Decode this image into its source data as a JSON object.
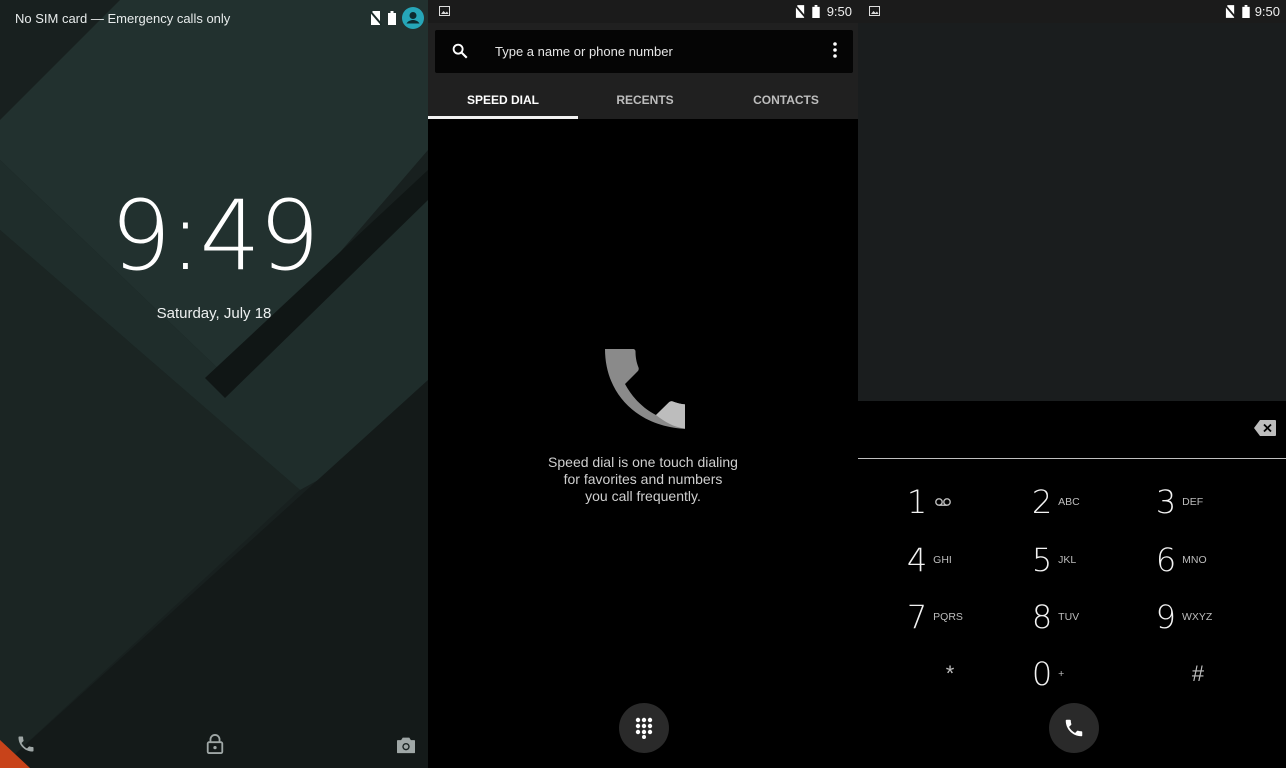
{
  "lockscreen": {
    "status_text": "No SIM card — Emergency calls only",
    "time": "9:49",
    "date": "Saturday, July 18"
  },
  "dialer": {
    "status_time": "9:50",
    "search_placeholder": "Type a name or phone number",
    "tabs": [
      {
        "label": "SPEED DIAL",
        "active": true
      },
      {
        "label": "RECENTS",
        "active": false
      },
      {
        "label": "CONTACTS",
        "active": false
      }
    ],
    "empty_message": "Speed dial is one touch dialing\nfor favorites and numbers\nyou call frequently."
  },
  "dialpad": {
    "status_time": "9:50",
    "keys": [
      {
        "digit": "1",
        "letters": ""
      },
      {
        "digit": "2",
        "letters": "ABC"
      },
      {
        "digit": "3",
        "letters": "DEF"
      },
      {
        "digit": "4",
        "letters": "GHI"
      },
      {
        "digit": "5",
        "letters": "JKL"
      },
      {
        "digit": "6",
        "letters": "MNO"
      },
      {
        "digit": "7",
        "letters": "PQRS"
      },
      {
        "digit": "8",
        "letters": "TUV"
      },
      {
        "digit": "9",
        "letters": "WXYZ"
      },
      {
        "digit": "*",
        "letters": ""
      },
      {
        "digit": "0",
        "letters": "+"
      },
      {
        "digit": "#",
        "letters": ""
      }
    ]
  },
  "colors": {
    "accent_teal": "#26a6b8",
    "wallpaper_dark": "#1b2b29",
    "wallpaper_corner": "#c8431a"
  }
}
